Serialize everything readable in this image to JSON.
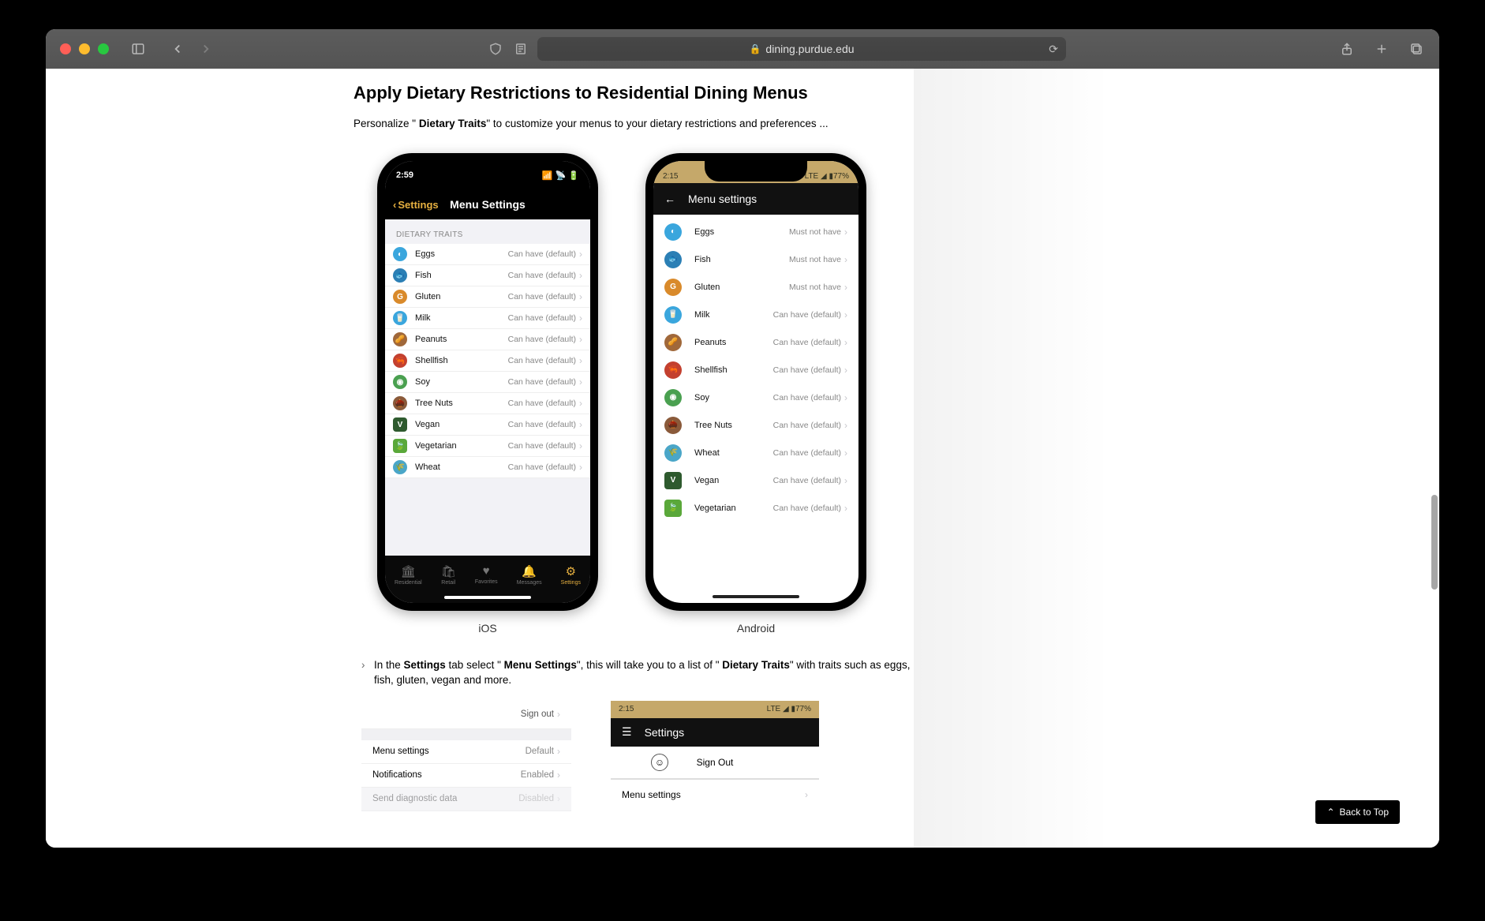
{
  "browser": {
    "url": "dining.purdue.edu"
  },
  "article": {
    "heading": "Apply Dietary Restrictions to Residential Dining Menus",
    "lead_pre": "Personalize \" ",
    "lead_bold": "Dietary Traits",
    "lead_post": "\" to customize your menus to your dietary restrictions and preferences ...",
    "caption_ios": "iOS",
    "caption_android": "Android",
    "instr_pre": "In the ",
    "instr_b1": "Settings",
    "instr_mid1": " tab select \" ",
    "instr_b2": "Menu Settings",
    "instr_mid2": "\", this will take you to a list of \" ",
    "instr_b3": "Dietary Traits",
    "instr_post": "\" with traits such as eggs, fish, gluten, vegan and more."
  },
  "ios": {
    "time": "2:59",
    "back": "Settings",
    "title": "Menu Settings",
    "section": "DIETARY TRAITS",
    "default_val": "Can have (default)",
    "traits": [
      {
        "name": "Eggs",
        "color": "#3aa6dd",
        "glyph": "◐"
      },
      {
        "name": "Fish",
        "color": "#2b7fb5",
        "glyph": "🐟"
      },
      {
        "name": "Gluten",
        "color": "#d98a2b",
        "glyph": "G"
      },
      {
        "name": "Milk",
        "color": "#3aa6dd",
        "glyph": "🥛"
      },
      {
        "name": "Peanuts",
        "color": "#a0683a",
        "glyph": "🥜"
      },
      {
        "name": "Shellfish",
        "color": "#c3402f",
        "glyph": "🦐"
      },
      {
        "name": "Soy",
        "color": "#4aa050",
        "glyph": "◉"
      },
      {
        "name": "Tree Nuts",
        "color": "#8a5a3a",
        "glyph": "🌰"
      },
      {
        "name": "Vegan",
        "color": "#2e5a2e",
        "glyph": "V",
        "sq": true
      },
      {
        "name": "Vegetarian",
        "color": "#5aa83a",
        "glyph": "🍃",
        "sq": true
      },
      {
        "name": "Wheat",
        "color": "#4aa6c8",
        "glyph": "🌾"
      }
    ],
    "tabs": [
      {
        "label": "Residential",
        "icon": "🏛"
      },
      {
        "label": "Retail",
        "icon": "🛍"
      },
      {
        "label": "Favorites",
        "icon": "♥"
      },
      {
        "label": "Messages",
        "icon": "🔔"
      },
      {
        "label": "Settings",
        "icon": "⚙",
        "active": true
      }
    ]
  },
  "android": {
    "time": "2:15",
    "status_right": "LTE ◢ ▮77%",
    "title": "Menu settings",
    "must_not": "Must not have",
    "default_val": "Can have (default)",
    "traits": [
      {
        "name": "Eggs",
        "val": "Must not have",
        "color": "#3aa6dd",
        "glyph": "◐"
      },
      {
        "name": "Fish",
        "val": "Must not have",
        "color": "#2b7fb5",
        "glyph": "🐟"
      },
      {
        "name": "Gluten",
        "val": "Must not have",
        "color": "#d98a2b",
        "glyph": "G"
      },
      {
        "name": "Milk",
        "val": "Can have (default)",
        "color": "#3aa6dd",
        "glyph": "🥛"
      },
      {
        "name": "Peanuts",
        "val": "Can have (default)",
        "color": "#a0683a",
        "glyph": "🥜"
      },
      {
        "name": "Shellfish",
        "val": "Can have (default)",
        "color": "#c3402f",
        "glyph": "🦐"
      },
      {
        "name": "Soy",
        "val": "Can have (default)",
        "color": "#4aa050",
        "glyph": "◉"
      },
      {
        "name": "Tree Nuts",
        "val": "Can have (default)",
        "color": "#8a5a3a",
        "glyph": "🌰"
      },
      {
        "name": "Wheat",
        "val": "Can have (default)",
        "color": "#4aa6c8",
        "glyph": "🌾"
      },
      {
        "name": "Vegan",
        "val": "Can have (default)",
        "color": "#2e5a2e",
        "glyph": "V",
        "sq": true
      },
      {
        "name": "Vegetarian",
        "val": "Can have (default)",
        "color": "#5aa83a",
        "glyph": "🍃",
        "sq": true
      }
    ]
  },
  "lower_ios": {
    "signout": "Sign out",
    "rows": [
      {
        "label": "Menu settings",
        "val": "Default"
      },
      {
        "label": "Notifications",
        "val": "Enabled"
      },
      {
        "label": "Send diagnostic data",
        "val": "Disabled"
      }
    ]
  },
  "lower_and": {
    "time": "2:15",
    "status_right": "LTE ◢ ▮77%",
    "title": "Settings",
    "signout": "Sign Out",
    "row1": "Menu settings"
  },
  "back_to_top": "Back to Top"
}
